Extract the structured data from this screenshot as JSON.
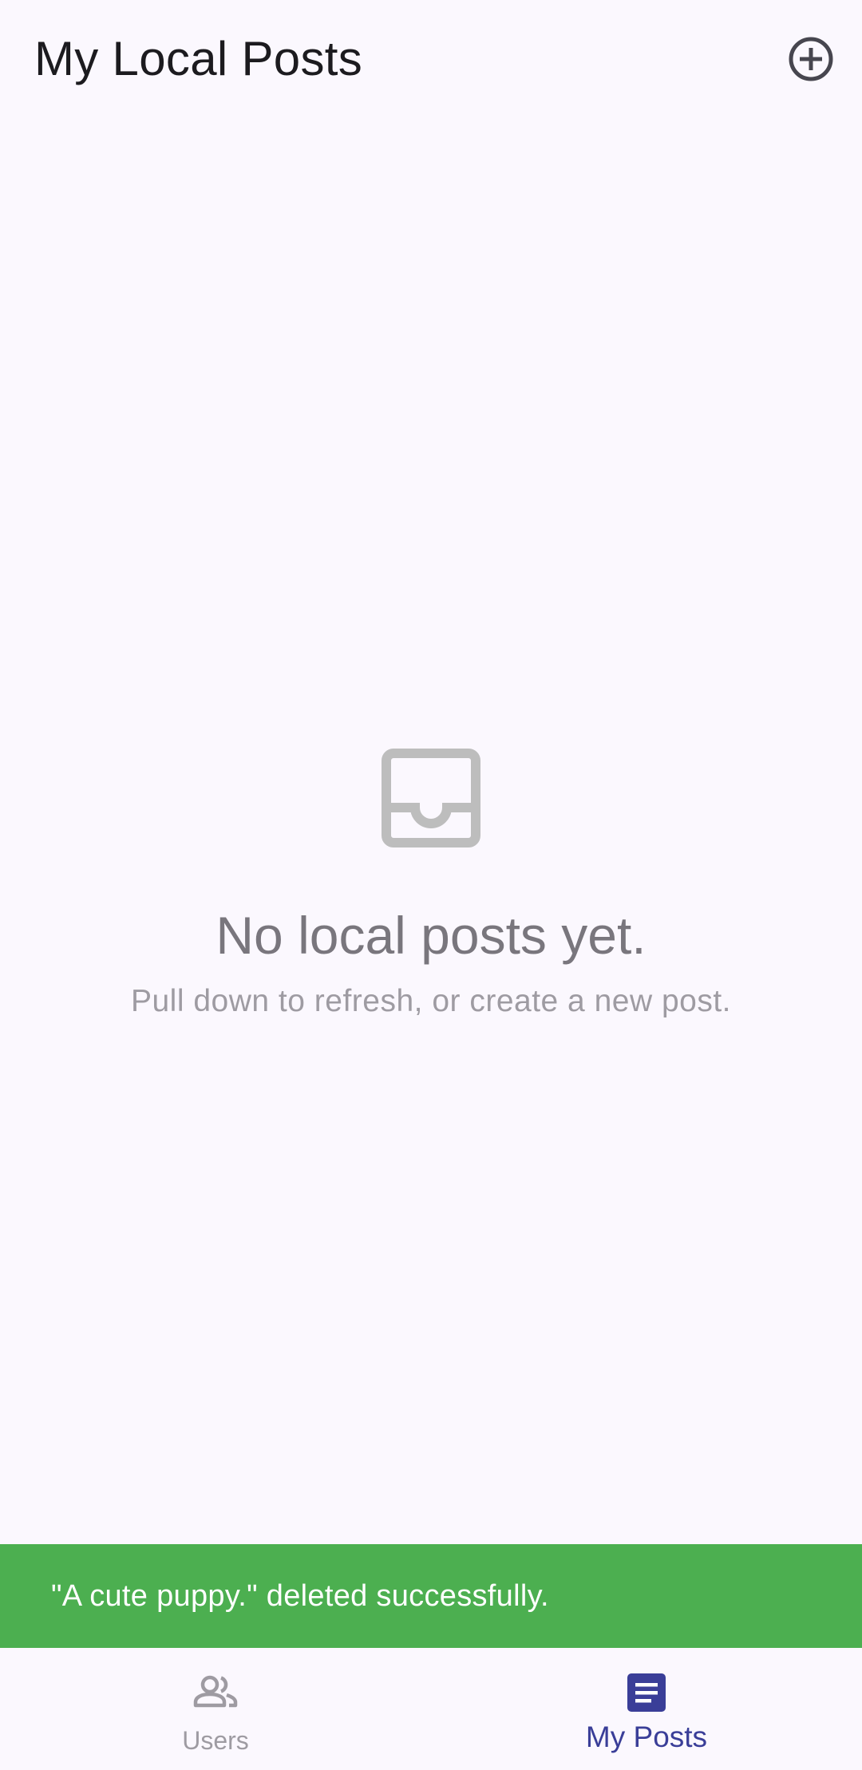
{
  "app_bar": {
    "title": "My Local Posts",
    "add_icon": "add-circle-outline-icon"
  },
  "empty_state": {
    "icon": "inbox-icon",
    "title": "No local posts yet.",
    "subtitle": "Pull down to refresh, or create a new post."
  },
  "snackbar": {
    "message": "\"A cute puppy.\" deleted successfully.",
    "color": "#4CAF50"
  },
  "bottom_nav": {
    "items": [
      {
        "label": "Users",
        "icon": "people-icon",
        "active": false
      },
      {
        "label": "My Posts",
        "icon": "article-icon",
        "active": true
      }
    ],
    "active_color": "#3A3E98",
    "inactive_color": "#9E9BA2"
  }
}
